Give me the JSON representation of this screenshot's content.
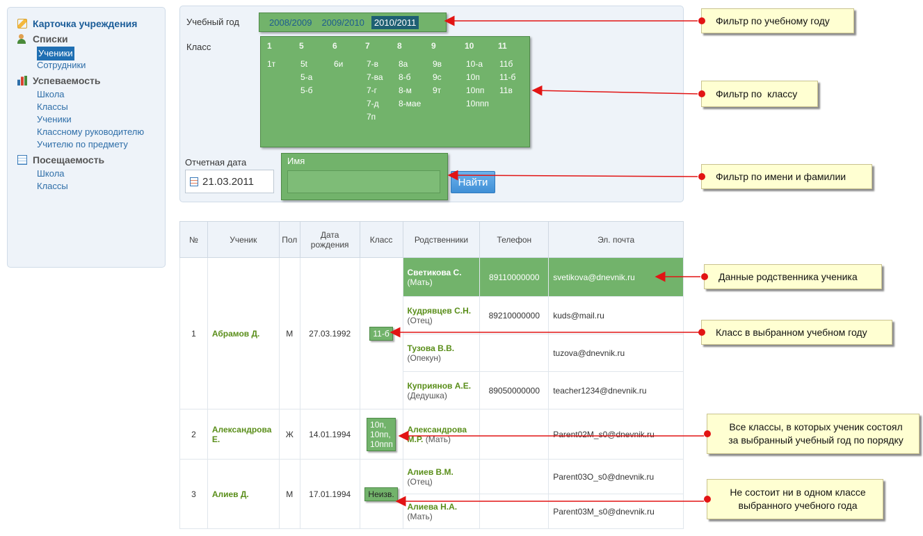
{
  "sidebar": {
    "card": "Карточка учреждения",
    "lists": {
      "title": "Списки",
      "items": [
        "Ученики",
        "Сотрудники"
      ]
    },
    "progress": {
      "title": "Успеваемость",
      "items": [
        "Школа",
        "Классы",
        "Ученики",
        "Классному руководителю",
        "Учителю по предмету"
      ]
    },
    "attendance": {
      "title": "Посещаемость",
      "items": [
        "Школа",
        "Классы"
      ]
    }
  },
  "filter": {
    "year_label": "Учебный год",
    "years": [
      "2008/2009",
      "2009/2010",
      "2010/2011"
    ],
    "class_label": "Класс",
    "class_headers": [
      "1",
      "5",
      "6",
      "7",
      "8",
      "9",
      "10",
      "11"
    ],
    "class_columns": [
      [
        "1т"
      ],
      [
        "5t",
        "5-а",
        "5-б"
      ],
      [
        "6и"
      ],
      [
        "7-в",
        "7-ва",
        "7-г",
        "7-д",
        "7п"
      ],
      [
        "8а",
        "8-б",
        "8-м",
        "8-мае"
      ],
      [
        "9в",
        "9с",
        "9т"
      ],
      [
        "10-а",
        "10п",
        "10пп",
        "10ппп"
      ],
      [
        "11б",
        "11-б",
        "11в"
      ]
    ],
    "date_label": "Отчетная дата",
    "date_value": "21.03.2011",
    "name_label": "Имя",
    "find_button": "Найти"
  },
  "table": {
    "headers": [
      "№",
      "Ученик",
      "Пол",
      "Дата рождения",
      "Класс",
      "Родственники",
      "Телефон",
      "Эл. почта"
    ],
    "rows": [
      {
        "num": "1",
        "student": "Абрамов Д.",
        "sex": "М",
        "birth": "27.03.1992",
        "classes": "11-б",
        "relatives": [
          {
            "name": "Светикова С.",
            "role": "(Мать)",
            "phone": "89110000000",
            "email": "svetikova@dnevnik.ru"
          },
          {
            "name": "Кудрявцев С.Н.",
            "role": "(Отец)",
            "phone": "89210000000",
            "email": "kuds@mail.ru"
          },
          {
            "name": "Тузова В.В.",
            "role": "(Опекун)",
            "phone": "",
            "email": "tuzova@dnevnik.ru"
          },
          {
            "name": "Куприянов А.Е.",
            "role": "(Дедушка)",
            "phone": "89050000000",
            "email": "teacher1234@dnevnik.ru"
          }
        ]
      },
      {
        "num": "2",
        "student": "Александрова Е.",
        "sex": "Ж",
        "birth": "14.01.1994",
        "classes": "10п, 10пп, 10ппп",
        "relatives": [
          {
            "name": "Александрова М.Р.",
            "role": "(Мать)",
            "phone": "",
            "email": "Parent02M_s0@dnevnik.ru"
          }
        ]
      },
      {
        "num": "3",
        "student": "Алиев Д.",
        "sex": "М",
        "birth": "17.01.1994",
        "classes": "Неизв.",
        "relatives": [
          {
            "name": "Алиев В.М.",
            "role": "(Отец)",
            "phone": "",
            "email": "Parent03O_s0@dnevnik.ru"
          },
          {
            "name": "Алиева Н.А.",
            "role": "(Мать)",
            "phone": "",
            "email": "Parent03M_s0@dnevnik.ru"
          }
        ]
      }
    ]
  },
  "callouts": {
    "year": "Фильтр по учебному году",
    "class": "Фильтр по  классу",
    "name": "Фильтр по имени и фамилии",
    "relative": "Данные родственника ученика",
    "class_year": "Класс в выбранном учебном году",
    "all_classes_1": "Все классы, в которых ученик состоял",
    "all_classes_2": "за выбранный учебный год по порядку",
    "none_1": "Не состоит ни в одном классе",
    "none_2": "выбранного учебного года"
  },
  "colors": {
    "highlight_green": "#72b36b",
    "callout_bg": "#ffffd2",
    "arrow_red": "#e21414",
    "link_blue": "#2e6ea8",
    "student_green": "#5a8e1a"
  }
}
